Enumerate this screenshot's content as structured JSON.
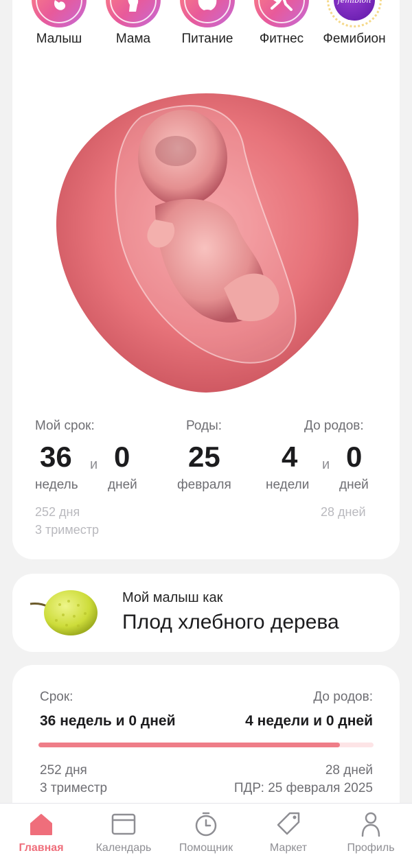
{
  "categories": [
    {
      "label": "Малыш",
      "icon": "baby-icon"
    },
    {
      "label": "Мама",
      "icon": "pregnant-icon"
    },
    {
      "label": "Питание",
      "icon": "apple-icon"
    },
    {
      "label": "Фитнес",
      "icon": "fitness-icon"
    },
    {
      "label": "Фемибион",
      "icon": "femibion-logo",
      "logo_text": "femibion"
    }
  ],
  "pregnancy": {
    "term_label": "Мой срок:",
    "weeks": "36",
    "and": "и",
    "days": "0",
    "weeks_unit": "недель",
    "days_unit": "дней",
    "days_total": "252 дня",
    "trimester": "3 триместр",
    "birth_label": "Роды:",
    "birth_day": "25",
    "birth_month": "февраля",
    "until_label": "До родов:",
    "until_weeks": "4",
    "until_days": "0",
    "until_weeks_unit": "недели",
    "until_days_unit": "дней",
    "until_total": "28 дней"
  },
  "fruit": {
    "caption": "Мой малыш как",
    "name": "Плод хлебного дерева",
    "icon": "breadfruit-icon"
  },
  "term_card": {
    "term_label": "Срок:",
    "term_value": "36 недель и 0 дней",
    "until_label": "До родов:",
    "until_value": "4 недели и 0 дней",
    "progress": 0.9,
    "days": "252 дня",
    "trimester": "3 триместр",
    "until_days": "28 дней",
    "due_date": "ПДР: 25 февраля 2025"
  },
  "nav": [
    {
      "label": "Главная",
      "icon": "home-icon",
      "active": true
    },
    {
      "label": "Календарь",
      "icon": "calendar-icon",
      "active": false
    },
    {
      "label": "Помощник",
      "icon": "timer-icon",
      "active": false
    },
    {
      "label": "Маркет",
      "icon": "tag-icon",
      "active": false
    },
    {
      "label": "Профиль",
      "icon": "profile-icon",
      "active": false
    }
  ],
  "colors": {
    "accent": "#ef6e7b",
    "progress_fill": "#ef7d88",
    "progress_track": "#fde4e6",
    "femibion": "#6a1fb0"
  }
}
